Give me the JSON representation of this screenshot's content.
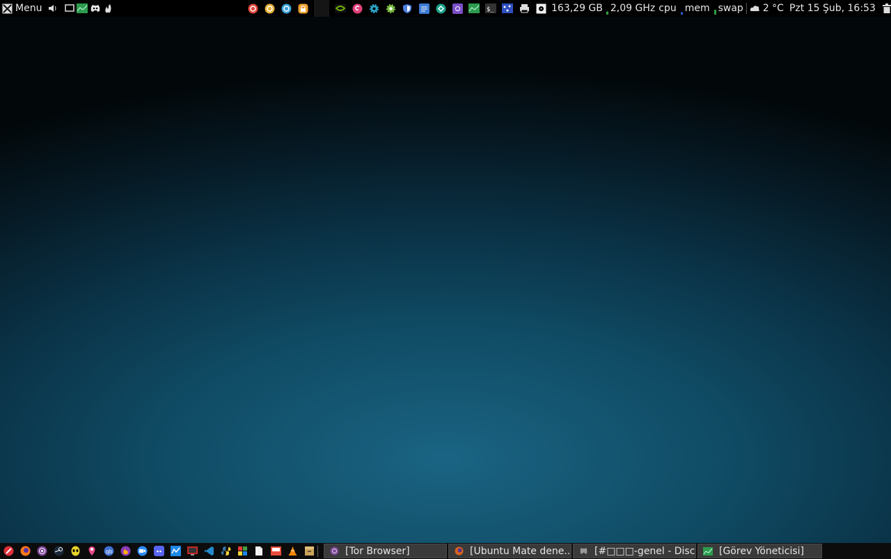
{
  "top_panel": {
    "menu_label": "Menu",
    "disk_free": "163,29 GB",
    "cpu_freq": "2,09 GHz",
    "cpu_label": "cpu",
    "mem_label": "mem",
    "swap_label": "swap",
    "weather": "2 °C",
    "clock": "Pzt 15 Şub, 16:53"
  },
  "taskbar": {
    "windows": [
      {
        "label": "[Tor Browser]",
        "icon": "tor-icon"
      },
      {
        "label": "[Ubuntu Mate dene...",
        "icon": "firefox-icon"
      },
      {
        "label": "[#□□□-genel - Discord]",
        "icon": "discord-icon"
      },
      {
        "label": "[Görev Yöneticisi]",
        "icon": "system-monitor-icon"
      }
    ]
  },
  "colors": {
    "panel_bg": "#000000",
    "taskbar_button_bg": "#3a3a3a",
    "wallpaper_center": "#1a6483",
    "wallpaper_edge": "#020709"
  }
}
